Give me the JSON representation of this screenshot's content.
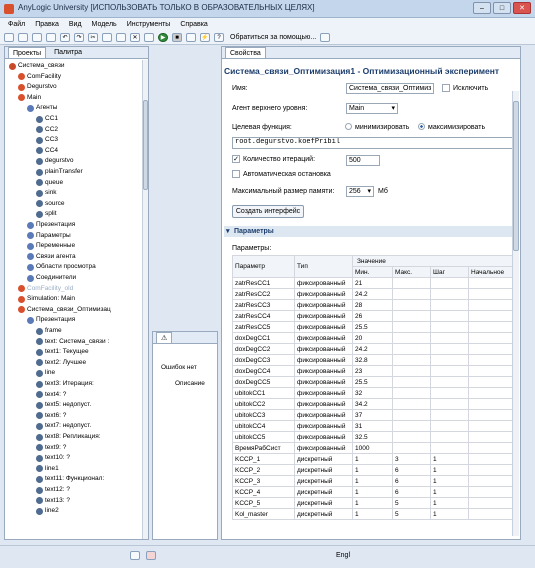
{
  "window": {
    "title": "AnyLogic University [ИСПОЛЬЗОВАТЬ ТОЛЬКО В ОБРАЗОВАТЕЛЬНЫХ ЦЕЛЯХ]"
  },
  "menu": [
    "Файл",
    "Правка",
    "Вид",
    "Модель",
    "Инструменты",
    "Справка"
  ],
  "toolbar": {
    "help_label": "Обратиться за помощью..."
  },
  "projects": {
    "tab_projects": "Проекты",
    "tab_palette": "Палитра",
    "items": [
      "Система_связи",
      "ComFacility",
      "Degurstvo",
      "Main",
      "Агенты",
      "CC1",
      "CC2",
      "CC3",
      "CC4",
      "degurstvo",
      "plainTransfer",
      "queue",
      "sink",
      "source",
      "split",
      "Презентация",
      "Параметры",
      "Переменные",
      "Связи агента",
      "Области просмотра",
      "Соединители",
      "ComFacility_old",
      "Simulation: Main",
      "Система_связи_Оптимизац",
      "Презентация",
      "frame",
      "text: Система_связи :",
      "text1: Текущее",
      "text2: Лучшее",
      "line",
      "text3: Итерация:",
      "text4: ?",
      "text5: недопуст.",
      "text6: ?",
      "text7: недопуст.",
      "text8: Репликация:",
      "text9: ?",
      "text10: ?",
      "line1",
      "text11: Функционал:",
      "text12: ?",
      "text13: ?",
      "line2"
    ]
  },
  "problems": {
    "no_errors": "Ошибок нет",
    "col_desc": "Описание"
  },
  "properties": {
    "tab": "Свойства",
    "title": "Система_связи_Оптимизация1 - Оптимизационный эксперимент",
    "name_label": "Имя:",
    "name_value": "Система_связи_Оптимиз",
    "exclude_label": "Исключить",
    "top_agent_label": "Агент верхнего уровня:",
    "top_agent_value": "Main",
    "goal_label": "Целевая функция:",
    "minimize": "минимизировать",
    "maximize": "максимизировать",
    "goal_expr": "root.degurstvo.koefPribil",
    "iter_label": "Количество итераций:",
    "iter_value": "500",
    "autostop_label": "Автоматическая остановка",
    "mem_label": "Максимальный размер памяти:",
    "mem_value": "256",
    "mem_unit": "Мб",
    "create_ui_button": "Создать интерфейс",
    "params_section": "Параметры",
    "params_label": "Параметры:",
    "col_param": "Параметр",
    "col_type": "Тип",
    "col_value": "Значение",
    "col_min": "Мин.",
    "col_max": "Макс.",
    "col_step": "Шаг",
    "col_initial": "Начальное",
    "rows": [
      [
        "zatrResCC1",
        "фиксированный",
        "21",
        "",
        "",
        ""
      ],
      [
        "zatrResCC2",
        "фиксированный",
        "24.2",
        "",
        "",
        ""
      ],
      [
        "zatrResCC3",
        "фиксированный",
        "28",
        "",
        "",
        ""
      ],
      [
        "zatrResCC4",
        "фиксированный",
        "26",
        "",
        "",
        ""
      ],
      [
        "zatrResCC5",
        "фиксированный",
        "25.5",
        "",
        "",
        ""
      ],
      [
        "doxDegCC1",
        "фиксированный",
        "20",
        "",
        "",
        ""
      ],
      [
        "doxDegCC2",
        "фиксированный",
        "24.2",
        "",
        "",
        ""
      ],
      [
        "doxDegCC3",
        "фиксированный",
        "32.8",
        "",
        "",
        ""
      ],
      [
        "doxDegCC4",
        "фиксированный",
        "23",
        "",
        "",
        ""
      ],
      [
        "doxDegCC5",
        "фиксированный",
        "25.5",
        "",
        "",
        ""
      ],
      [
        "ubitokCC1",
        "фиксированный",
        "32",
        "",
        "",
        ""
      ],
      [
        "ubitokCC2",
        "фиксированный",
        "34.2",
        "",
        "",
        ""
      ],
      [
        "ubitokCC3",
        "фиксированный",
        "37",
        "",
        "",
        ""
      ],
      [
        "ubitokCC4",
        "фиксированный",
        "31",
        "",
        "",
        ""
      ],
      [
        "ubitokCC5",
        "фиксированный",
        "32.5",
        "",
        "",
        ""
      ],
      [
        "ВремяРабСист",
        "фиксированный",
        "1000",
        "",
        "",
        ""
      ],
      [
        "KCCP_1",
        "дискретный",
        "1",
        "3",
        "1",
        ""
      ],
      [
        "KCCP_2",
        "дискретный",
        "1",
        "6",
        "1",
        ""
      ],
      [
        "KCCP_3",
        "дискретный",
        "1",
        "6",
        "1",
        ""
      ],
      [
        "KCCP_4",
        "дискретный",
        "1",
        "6",
        "1",
        ""
      ],
      [
        "KCCP_5",
        "дискретный",
        "1",
        "5",
        "1",
        ""
      ],
      [
        "Kol_master",
        "дискретный",
        "1",
        "5",
        "1",
        ""
      ]
    ]
  },
  "status": {
    "lang": "Еngl"
  }
}
